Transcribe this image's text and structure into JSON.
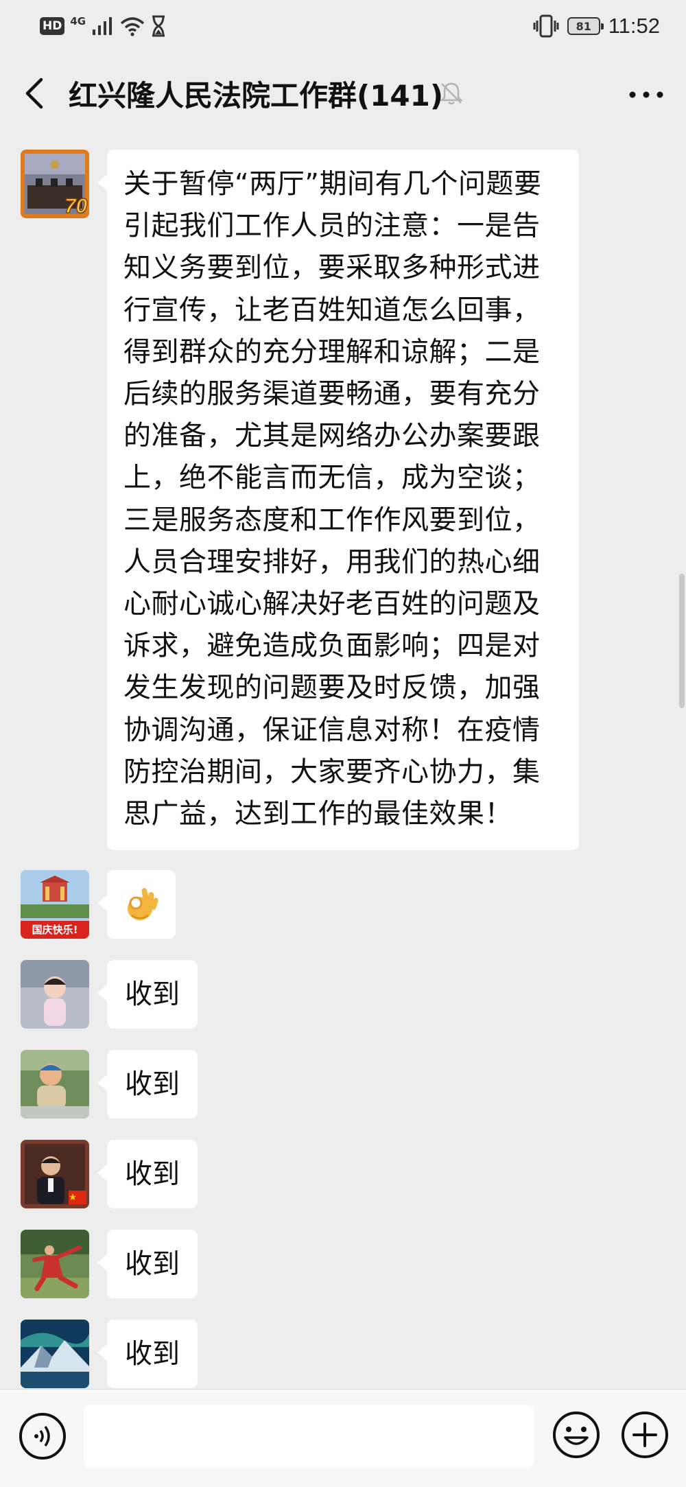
{
  "status_bar": {
    "hd": "HD",
    "network": "4G",
    "battery": "81",
    "time": "11:52"
  },
  "nav": {
    "title": "红兴隆人民法院工作群(141)",
    "icons": [
      "back-icon",
      "mute-bell-icon",
      "more-icon"
    ]
  },
  "messages": [
    {
      "type": "text",
      "avatar": "avatar-courtroom-70",
      "text": "关于暂停“两厅”期间有几个问题要引起我们工作人员的注意：一是告知义务要到位，要采取多种形式进行宣传，让老百姓知道怎么回事，得到群众的充分理解和谅解；二是后续的服务渠道要畅通，要有充分的准备，尤其是网络办公办案要跟上，绝不能言而无信，成为空谈；三是服务态度和工作作风要到位，人员合理安排好，用我们的热心细心耐心诚心解决好老百姓的问题及诉求，避免造成负面影响；四是对发生发现的问题要及时反馈，加强协调沟通，保证信息对称！在疫情防控治期间，大家要齐心协力，集思广益，达到工作的最佳效果！"
    },
    {
      "type": "emoji",
      "avatar": "avatar-national-day",
      "avatar_label": "国庆快乐!",
      "emoji": "ok-hand-emoji"
    },
    {
      "type": "text",
      "avatar": "avatar-baby",
      "text": "收到"
    },
    {
      "type": "text",
      "avatar": "avatar-child",
      "text": "收到"
    },
    {
      "type": "text",
      "avatar": "avatar-man-flag",
      "text": "收到"
    },
    {
      "type": "text",
      "avatar": "avatar-taichi",
      "text": "收到"
    },
    {
      "type": "text",
      "avatar": "avatar-mountain-aurora",
      "text": "收到"
    }
  ],
  "input_bar": {
    "placeholder": "",
    "icons": [
      "voice-icon",
      "emoji-icon",
      "plus-icon"
    ]
  }
}
